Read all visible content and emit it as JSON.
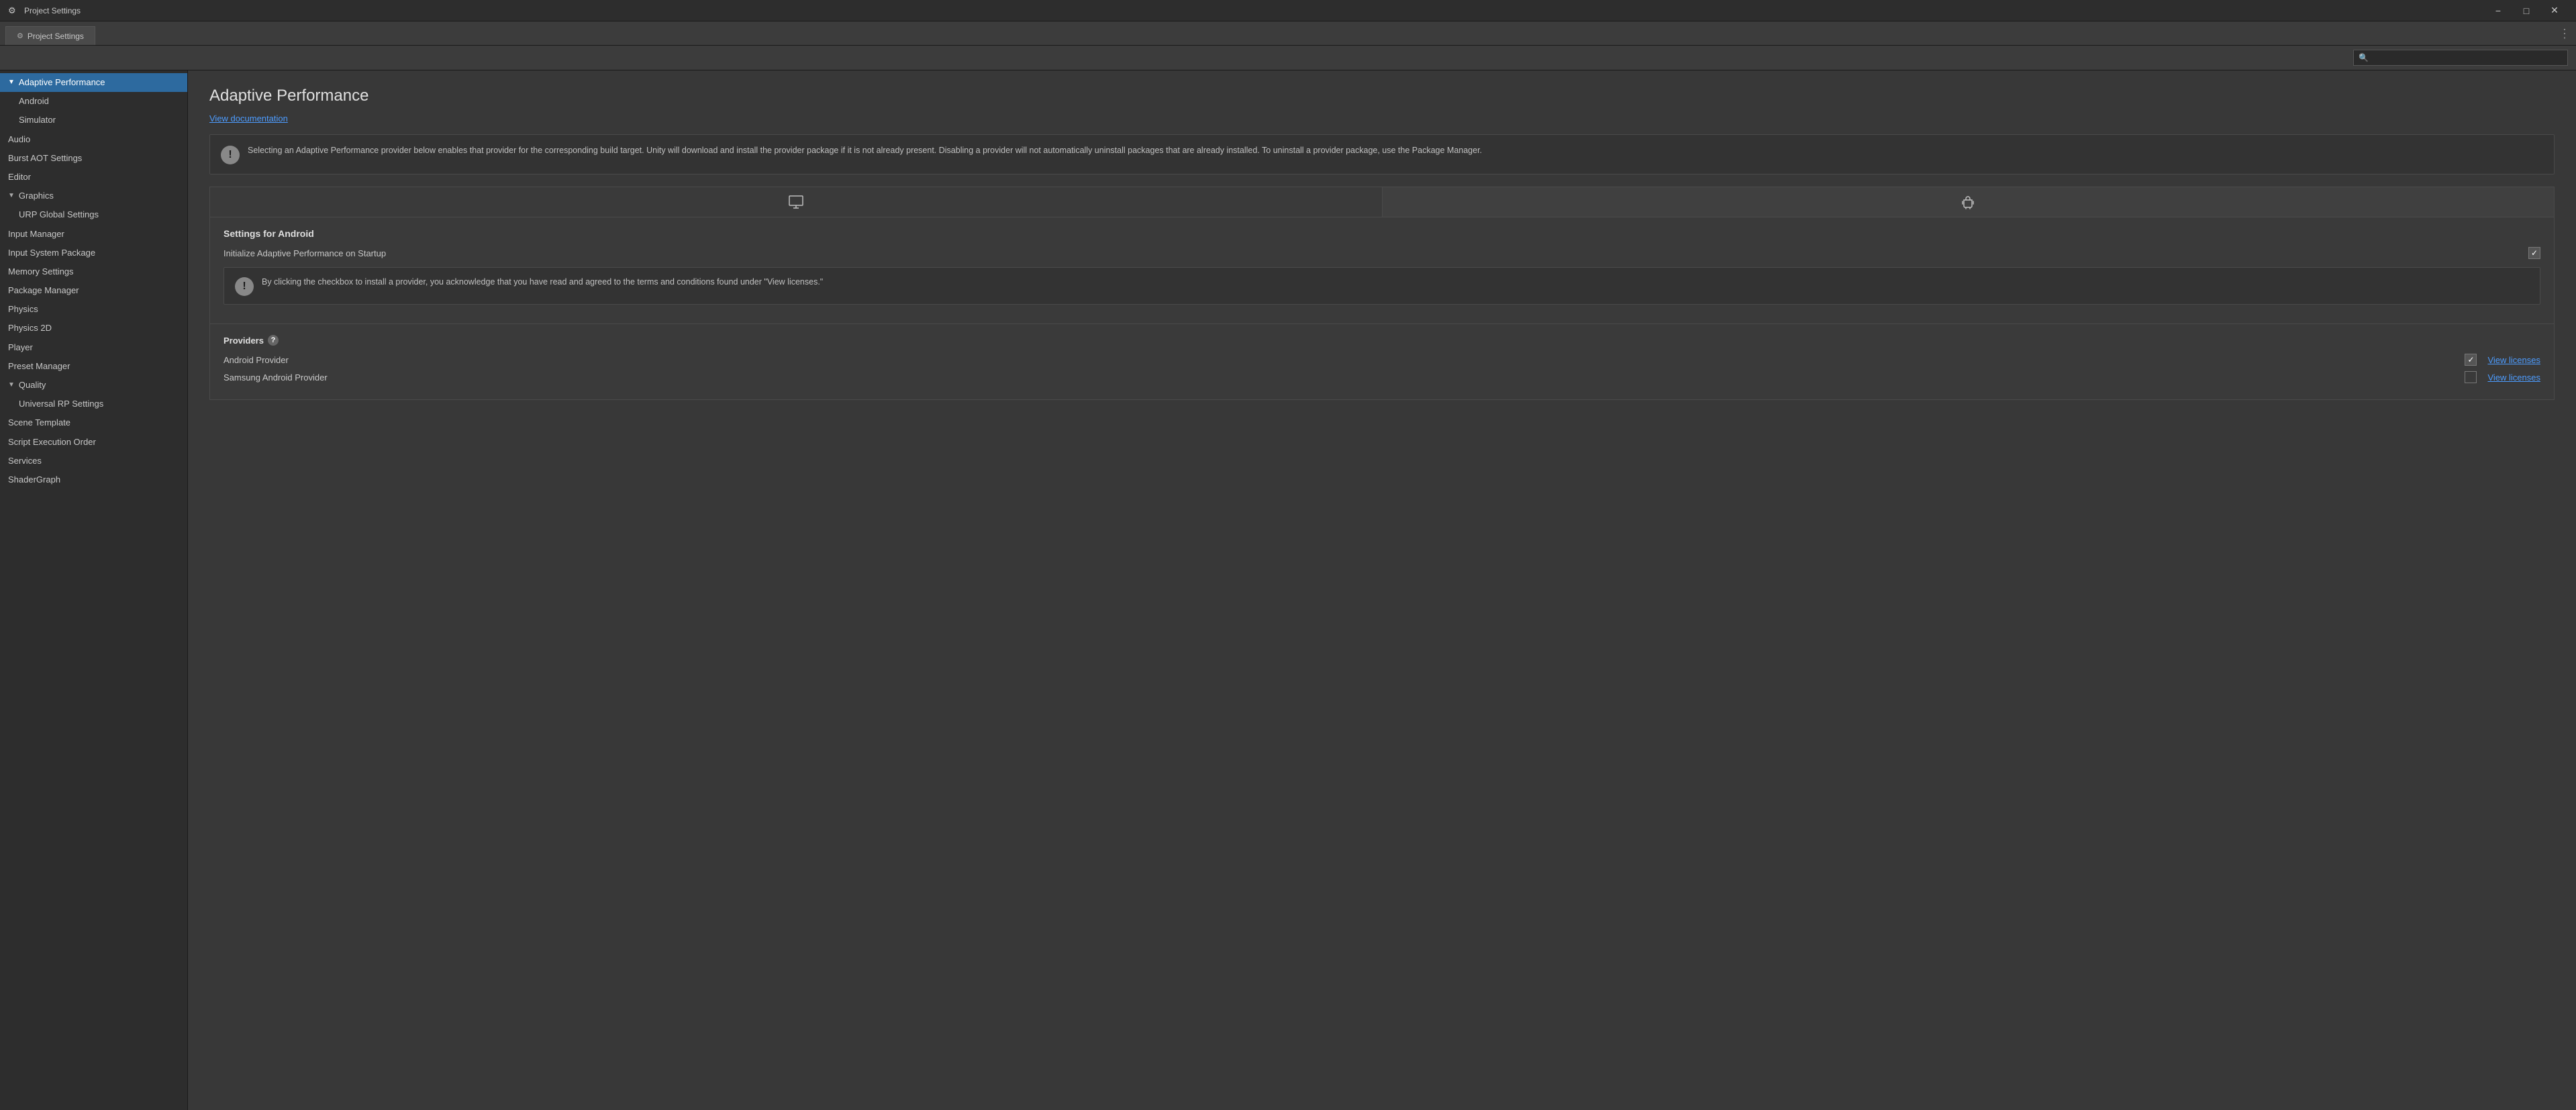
{
  "titleBar": {
    "icon": "⚙",
    "title": "Project Settings",
    "controls": {
      "minimize": "−",
      "maximize": "□",
      "close": "✕"
    }
  },
  "tabBar": {
    "activeTab": {
      "icon": "⚙",
      "label": "Project Settings"
    },
    "optionsIcon": "⋮"
  },
  "search": {
    "placeholder": ""
  },
  "sidebar": {
    "items": [
      {
        "id": "adaptive-performance",
        "label": "Adaptive Performance",
        "indent": 0,
        "arrow": "▼",
        "selected": true
      },
      {
        "id": "android",
        "label": "Android",
        "indent": 1,
        "arrow": "",
        "selected": false
      },
      {
        "id": "simulator",
        "label": "Simulator",
        "indent": 1,
        "arrow": "",
        "selected": false
      },
      {
        "id": "audio",
        "label": "Audio",
        "indent": 0,
        "arrow": "",
        "selected": false
      },
      {
        "id": "burst-aot",
        "label": "Burst AOT Settings",
        "indent": 0,
        "arrow": "",
        "selected": false
      },
      {
        "id": "editor",
        "label": "Editor",
        "indent": 0,
        "arrow": "",
        "selected": false
      },
      {
        "id": "graphics",
        "label": "Graphics",
        "indent": 0,
        "arrow": "▼",
        "selected": false
      },
      {
        "id": "urp-global",
        "label": "URP Global Settings",
        "indent": 1,
        "arrow": "",
        "selected": false
      },
      {
        "id": "input-manager",
        "label": "Input Manager",
        "indent": 0,
        "arrow": "",
        "selected": false
      },
      {
        "id": "input-system",
        "label": "Input System Package",
        "indent": 0,
        "arrow": "",
        "selected": false
      },
      {
        "id": "memory-settings",
        "label": "Memory Settings",
        "indent": 0,
        "arrow": "",
        "selected": false
      },
      {
        "id": "package-manager",
        "label": "Package Manager",
        "indent": 0,
        "arrow": "",
        "selected": false
      },
      {
        "id": "physics",
        "label": "Physics",
        "indent": 0,
        "arrow": "",
        "selected": false
      },
      {
        "id": "physics-2d",
        "label": "Physics 2D",
        "indent": 0,
        "arrow": "",
        "selected": false
      },
      {
        "id": "player",
        "label": "Player",
        "indent": 0,
        "arrow": "",
        "selected": false
      },
      {
        "id": "preset-manager",
        "label": "Preset Manager",
        "indent": 0,
        "arrow": "",
        "selected": false
      },
      {
        "id": "quality",
        "label": "Quality",
        "indent": 0,
        "arrow": "▼",
        "selected": false
      },
      {
        "id": "universal-rp",
        "label": "Universal RP Settings",
        "indent": 1,
        "arrow": "",
        "selected": false
      },
      {
        "id": "scene-template",
        "label": "Scene Template",
        "indent": 0,
        "arrow": "",
        "selected": false
      },
      {
        "id": "script-execution",
        "label": "Script Execution Order",
        "indent": 0,
        "arrow": "",
        "selected": false
      },
      {
        "id": "services",
        "label": "Services",
        "indent": 0,
        "arrow": "",
        "selected": false
      },
      {
        "id": "shader-graph",
        "label": "ShaderGraph",
        "indent": 0,
        "arrow": "",
        "selected": false
      }
    ]
  },
  "content": {
    "title": "Adaptive Performance",
    "docLink": "View documentation",
    "infoBox": {
      "text": "Selecting an Adaptive Performance provider below enables that provider for the corresponding build target. Unity will download and install the provider package if it is not already present. Disabling a provider will not automatically uninstall packages that are already installed. To uninstall a provider package, use the Package Manager."
    },
    "platformTabs": [
      {
        "id": "desktop",
        "icon": "desktop",
        "active": false
      },
      {
        "id": "android",
        "icon": "android",
        "active": true
      }
    ],
    "settingsForAndroid": {
      "title": "Settings for Android",
      "initLabel": "Initialize Adaptive Performance on Startup",
      "initChecked": true
    },
    "warningBox": {
      "text": "By clicking the checkbox to install a provider, you acknowledge that you have read and agreed to the terms and conditions found under \"View licenses.\""
    },
    "providers": {
      "title": "Providers",
      "helpTooltip": "?",
      "items": [
        {
          "id": "android-provider",
          "label": "Android Provider",
          "checked": true,
          "viewLicenses": "View licenses"
        },
        {
          "id": "samsung-android-provider",
          "label": "Samsung Android Provider",
          "checked": false,
          "viewLicenses": "View licenses"
        }
      ]
    }
  },
  "colors": {
    "accent": "#2d6a9f",
    "link": "#4d9cff"
  }
}
